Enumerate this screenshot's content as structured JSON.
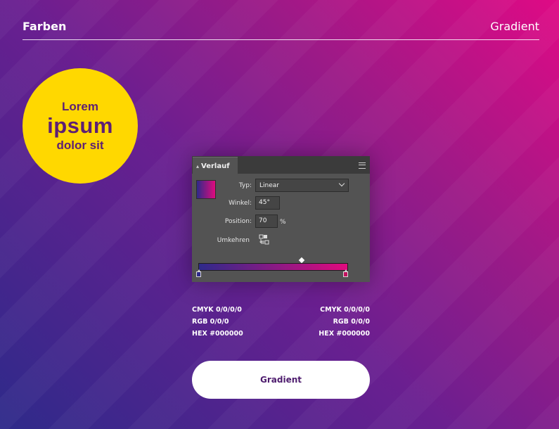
{
  "header": {
    "left_title": "Farben",
    "right_title": "Gradient"
  },
  "badge": {
    "line1": "Lorem",
    "line2": "ipsum",
    "line3": "dolor sit",
    "color": "#ffd800",
    "text_color": "#5d1f74"
  },
  "panel": {
    "tab_label": "Verlauf",
    "type_label": "Typ:",
    "type_value": "Linear",
    "angle_label": "Winkel:",
    "angle_value": "45°",
    "position_label": "Position:",
    "position_value": "70",
    "position_unit": "%",
    "reverse_label": "Umkehren",
    "gradient_start_color": "#2e2a8a",
    "gradient_end_color": "#e10a7e"
  },
  "info": {
    "left": {
      "cmyk": "CMYK 0/0/0/0",
      "rgb": "RGB 0/0/0",
      "hex": "HEX #000000"
    },
    "right": {
      "cmyk": "CMYK 0/0/0/0",
      "rgb": "RGB 0/0/0",
      "hex": "HEX #000000"
    }
  },
  "cta": {
    "label": "Gradient"
  }
}
